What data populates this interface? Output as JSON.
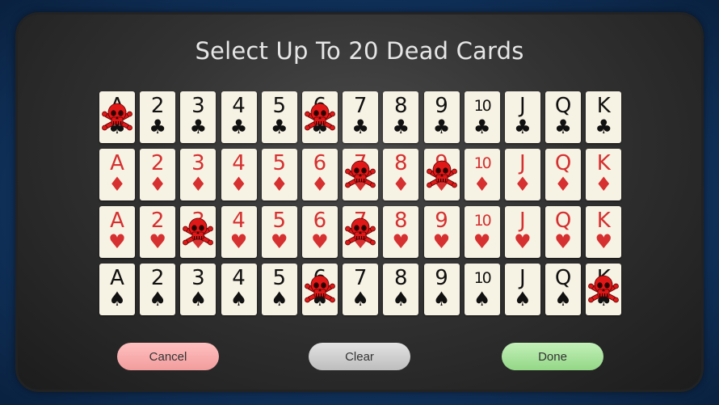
{
  "dialog": {
    "title": "Select Up To 20 Dead Cards"
  },
  "colors": {
    "red_suit": "#d63030",
    "black_suit": "#111111",
    "dead_marker": "#e01818",
    "cancel": "#f4a6a6",
    "clear": "#c9c9c9",
    "done": "#a3dd95"
  },
  "ranks": [
    "A",
    "2",
    "3",
    "4",
    "5",
    "6",
    "7",
    "8",
    "9",
    "10",
    "J",
    "Q",
    "K"
  ],
  "suits": [
    {
      "name": "clubs",
      "glyph": "♣",
      "color": "black"
    },
    {
      "name": "diamonds",
      "glyph": "♦",
      "color": "red"
    },
    {
      "name": "hearts",
      "glyph": "♥",
      "color": "red"
    },
    {
      "name": "spades",
      "glyph": "♠",
      "color": "black"
    }
  ],
  "dead_cards": [
    "A-clubs",
    "6-clubs",
    "7-diamonds",
    "9-diamonds",
    "3-hearts",
    "7-hearts",
    "6-spades",
    "K-spades"
  ],
  "dead_icon": "skull-crossbones-icon",
  "buttons": {
    "cancel": "Cancel",
    "clear": "Clear",
    "done": "Done"
  }
}
